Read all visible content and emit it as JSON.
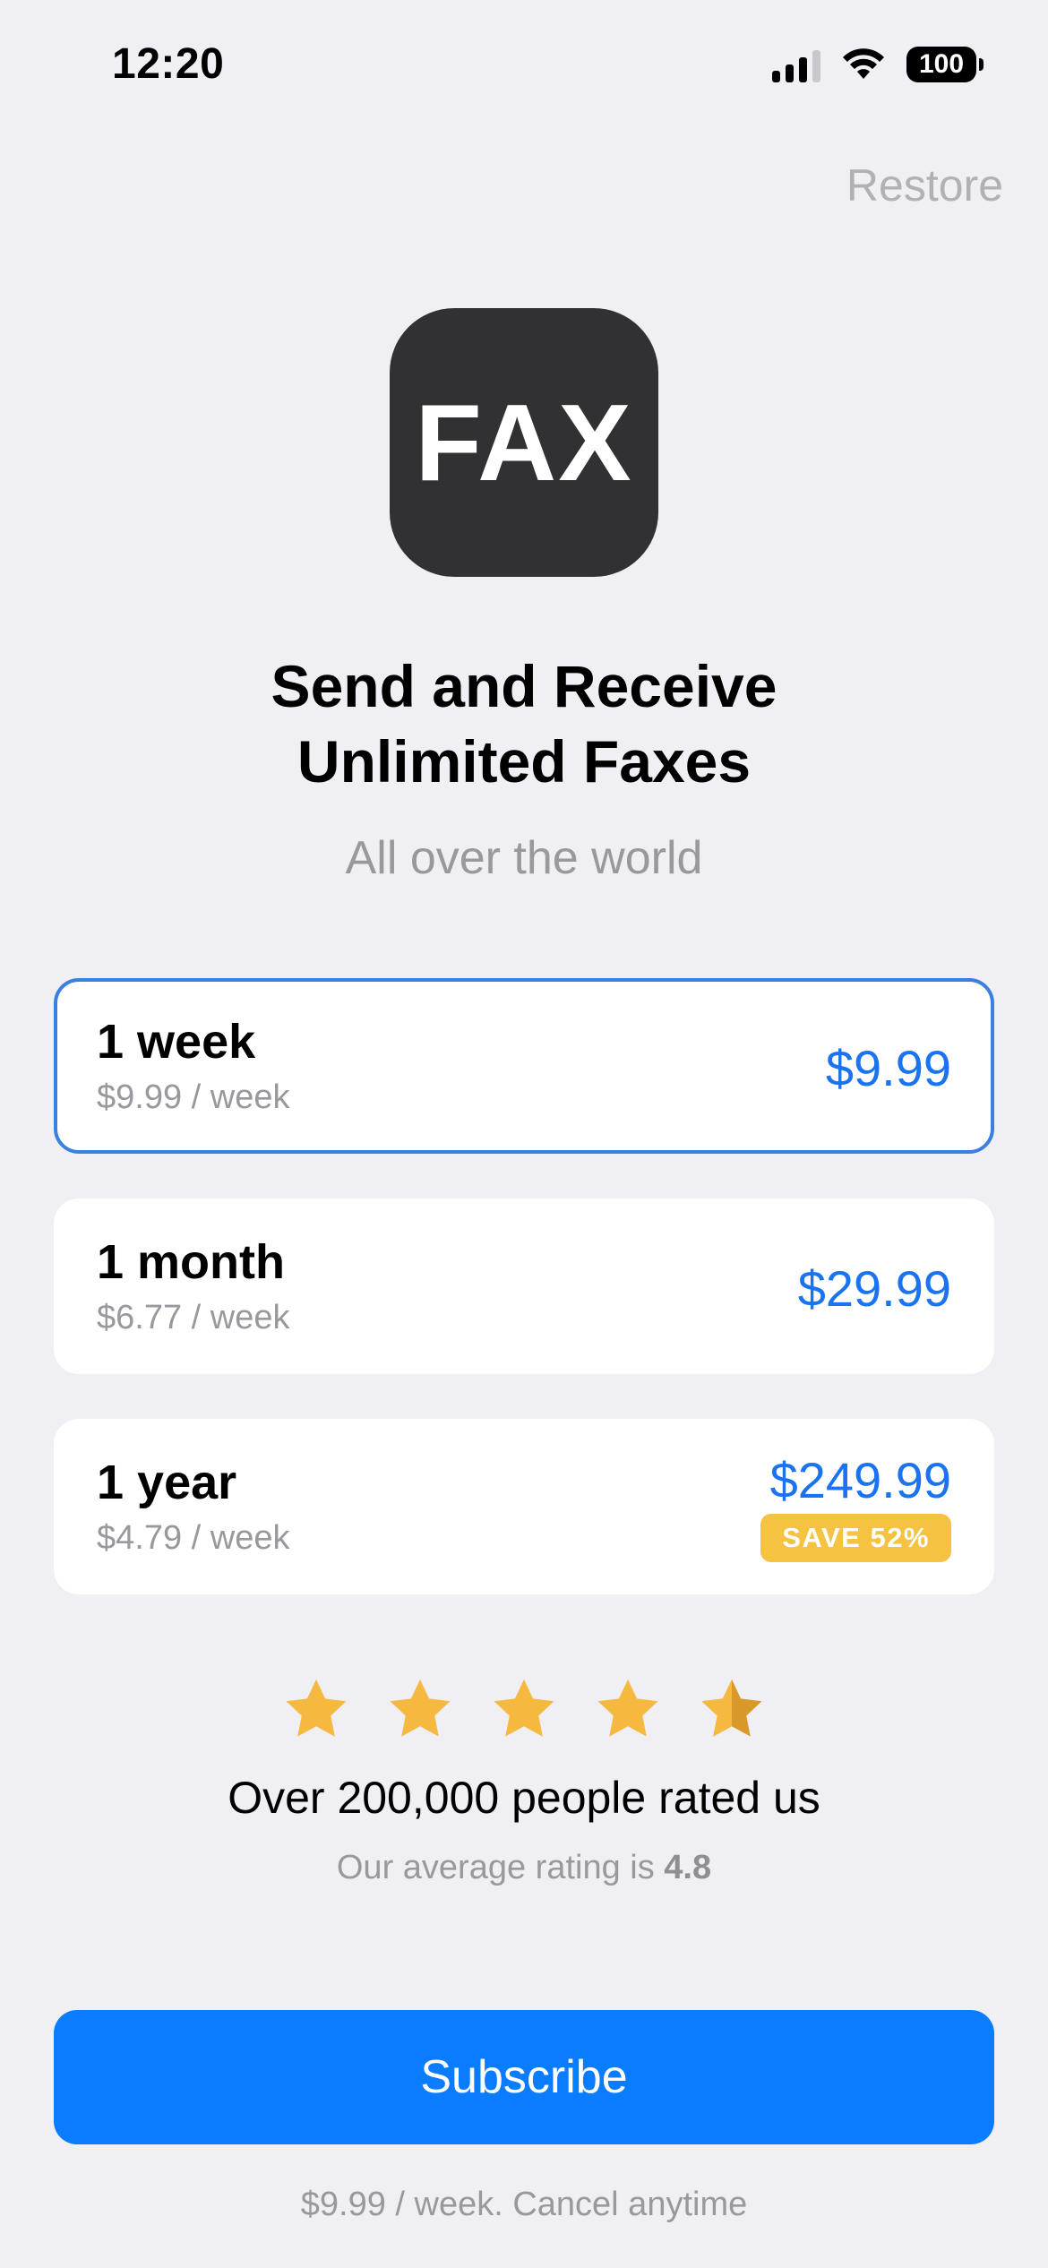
{
  "status_bar": {
    "time": "12:20",
    "battery": "100",
    "icons": [
      "cellular-signal-icon",
      "wifi-icon",
      "battery-icon"
    ]
  },
  "restore_label": "Restore",
  "app_icon_text": "FAX",
  "headline_line1": "Send and Receive",
  "headline_line2": "Unlimited Faxes",
  "subtitle": "All over the world",
  "plans": [
    {
      "name": "1 week",
      "per_week": "$9.99 / week",
      "price": "$9.99",
      "selected": true
    },
    {
      "name": "1 month",
      "per_week": "$6.77 / week",
      "price": "$29.99",
      "selected": false
    },
    {
      "name": "1 year",
      "per_week": "$4.79 / week",
      "price": "$249.99",
      "selected": false,
      "badge": "SAVE 52%"
    }
  ],
  "rating": {
    "stars": 4.5,
    "headline": "Over 200,000 people rated us",
    "average_prefix": "Our average rating is ",
    "average_value": "4.8"
  },
  "subscribe_label": "Subscribe",
  "footer_note": "$9.99 / week. Cancel anytime",
  "colors": {
    "accent": "#0a7cff",
    "price": "#1a73f0",
    "selected_border": "#3b7fe0",
    "badge": "#f5c242",
    "star": "#f5b940",
    "background": "#efeff4"
  }
}
